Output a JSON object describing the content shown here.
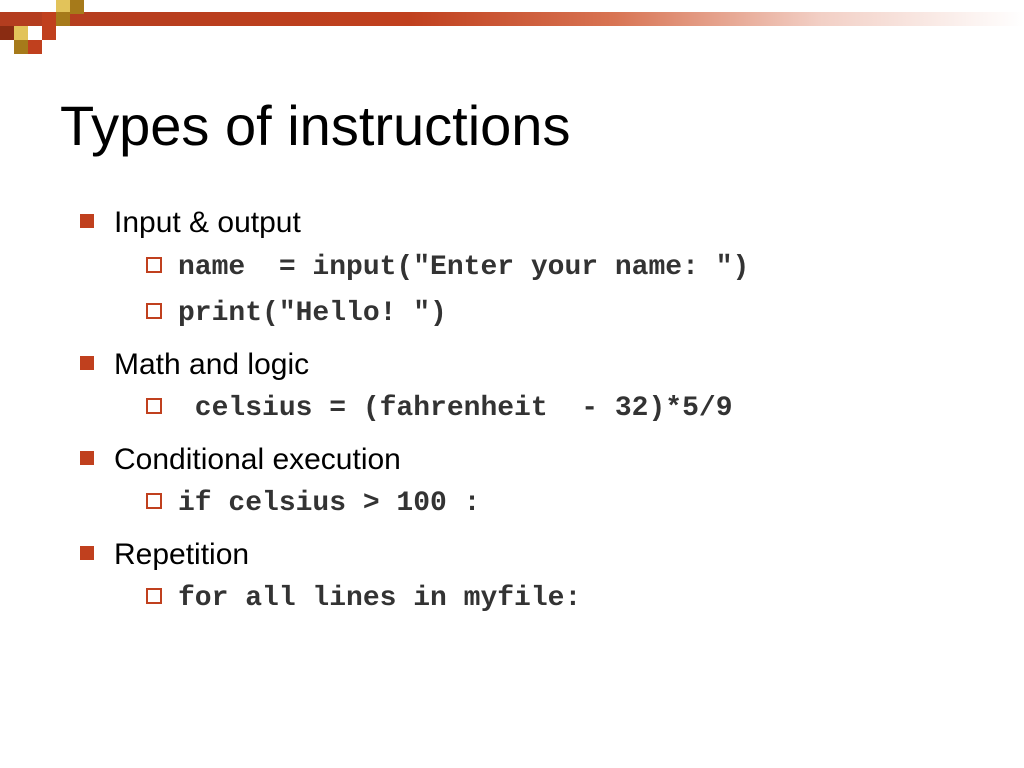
{
  "title": "Types of instructions",
  "colors": {
    "accent": "#c0401e",
    "gold_dark": "#a67a1a",
    "gold_light": "#e2c35a",
    "red_dark": "#8a2c12"
  },
  "items": [
    {
      "label": "Input & output",
      "subs": [
        {
          "code": "name  = input(\"Enter your name: \")"
        },
        {
          "code": "print(\"Hello! \")"
        }
      ]
    },
    {
      "label": "Math and logic",
      "subs": [
        {
          "code": " celsius = (fahrenheit  - 32)*5/9"
        }
      ]
    },
    {
      "label": "Conditional execution",
      "subs": [
        {
          "code": "if celsius > 100 :"
        }
      ]
    },
    {
      "label": "Repetition",
      "subs": [
        {
          "code": "for all lines in myfile:"
        }
      ]
    }
  ]
}
